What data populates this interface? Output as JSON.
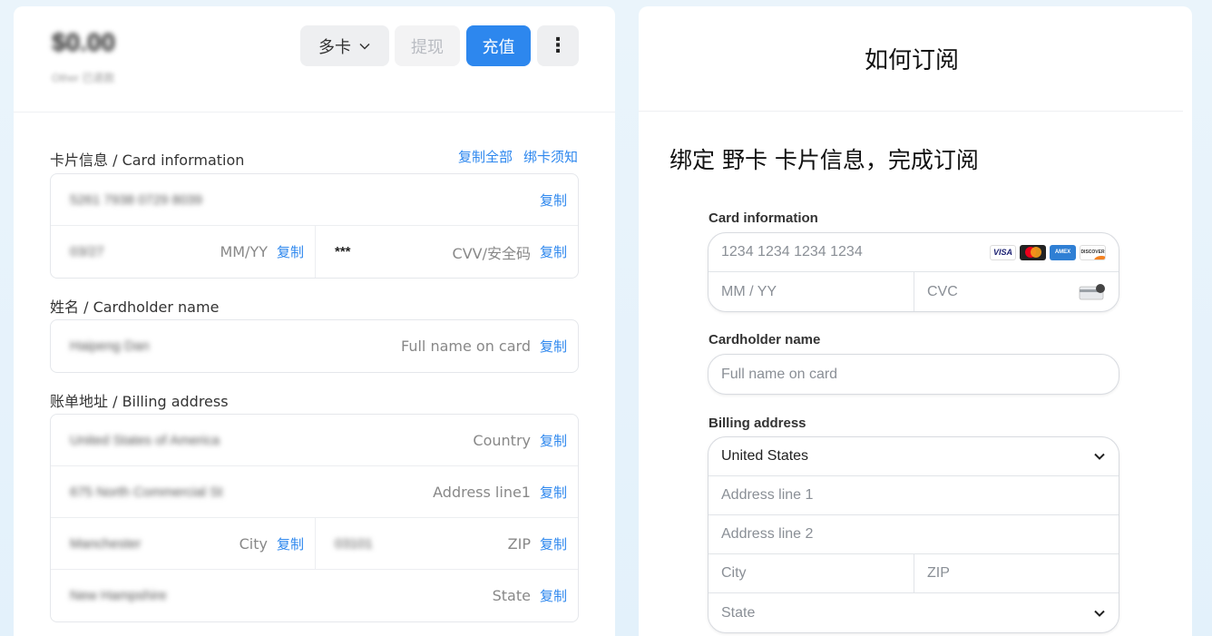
{
  "left": {
    "balance_amount": "$0.00",
    "balance_sub": "Other 已退款",
    "card_select_label": "多卡",
    "withdraw_label": "提现",
    "recharge_label": "充值",
    "more_label": "⋮",
    "card_info_label": "卡片信息 / Card information",
    "copy_all_label": "复制全部",
    "binding_notice_label": "绑卡须知",
    "card_number_value": "5261 7938 0729 8039",
    "expiry_value": "03/27",
    "expiry_hint": "MM/YY",
    "cvv_value": "***",
    "cvv_hint": "CVV/安全码",
    "name_label": "姓名 / Cardholder name",
    "name_value": "Haipeng Dan",
    "name_hint": "Full name on card",
    "billing_label": "账单地址 / Billing address",
    "country_value": "United States of America",
    "country_hint": "Country",
    "address_value": "675 North Commercial St",
    "address_hint": "Address line1",
    "city_value": "Manchester",
    "city_hint": "City",
    "zip_value": "03101",
    "zip_hint": "ZIP",
    "state_value": "New Hampshire",
    "state_hint": "State",
    "copy_label": "复制"
  },
  "right": {
    "title": "如何订阅",
    "subtitle": "绑定 野卡 卡片信息，完成订阅",
    "card_info_label": "Card information",
    "card_number_placeholder": "1234 1234 1234 1234",
    "expiry_placeholder": "MM / YY",
    "cvc_placeholder": "CVC",
    "brand_visa": "VISA",
    "brand_amex": "AMEX",
    "brand_discover": "DISCOVER",
    "cardholder_label": "Cardholder name",
    "cardholder_placeholder": "Full name on card",
    "billing_label": "Billing address",
    "country_value": "United States",
    "address1_placeholder": "Address line 1",
    "address2_placeholder": "Address line 2",
    "city_placeholder": "City",
    "zip_placeholder": "ZIP",
    "state_placeholder": "State"
  },
  "colors": {
    "accent": "#2d87ee",
    "background": "#e6f3fb"
  }
}
